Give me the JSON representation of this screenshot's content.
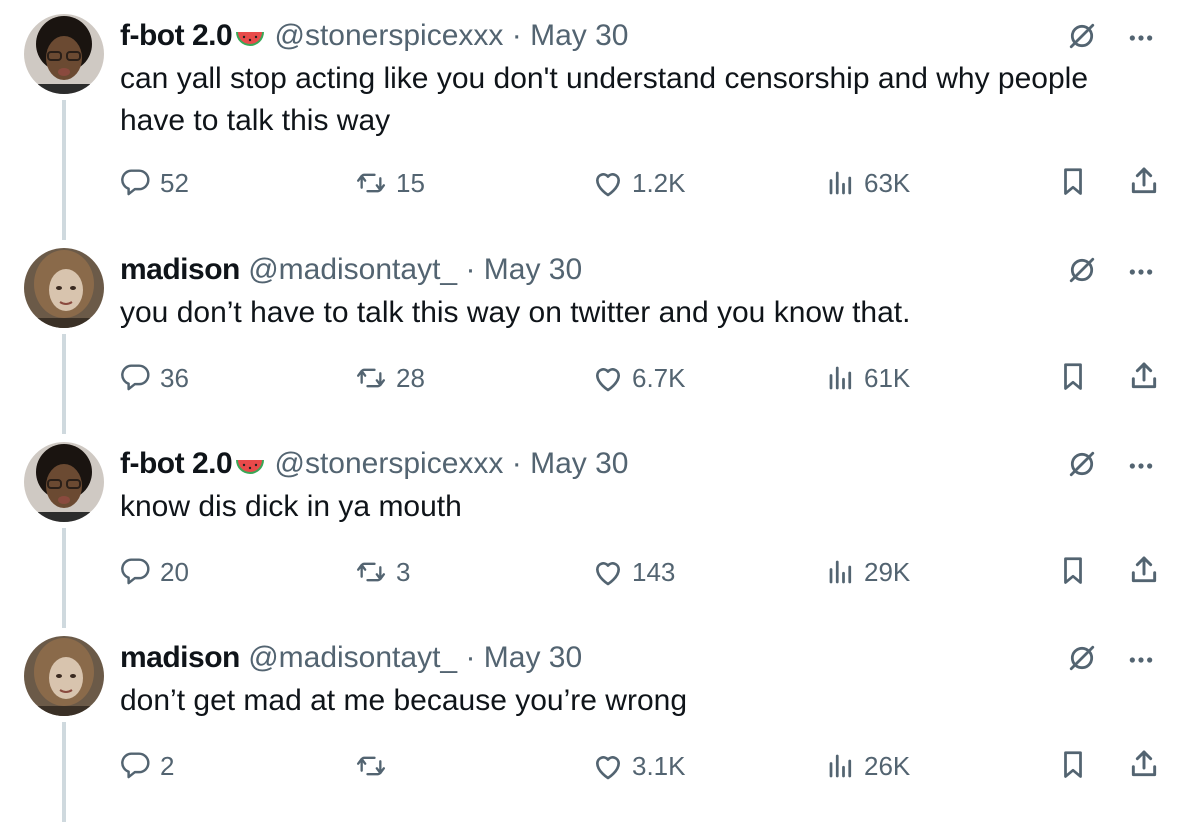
{
  "colors": {
    "text": "#0f1419",
    "muted": "#536471",
    "line": "#cfd9de"
  },
  "tweets": [
    {
      "name": "f-bot 2.0",
      "emoji": "watermelon-icon",
      "handle": "@stonerspicexxx",
      "dot": "·",
      "date": "May 30",
      "text": "can yall stop acting like you don't understand censorship and why people have to talk this way",
      "replies": "52",
      "reposts": "15",
      "likes": "1.2K",
      "views": "63K"
    },
    {
      "name": "madison",
      "emoji": "",
      "handle": "@madisontayt_",
      "dot": "·",
      "date": "May 30",
      "text": "you don’t have to talk this way on twitter and you know that.",
      "replies": "36",
      "reposts": "28",
      "likes": "6.7K",
      "views": "61K"
    },
    {
      "name": "f-bot 2.0",
      "emoji": "watermelon-icon",
      "handle": "@stonerspicexxx",
      "dot": "·",
      "date": "May 30",
      "text": "know dis dick in ya mouth",
      "replies": "20",
      "reposts": "3",
      "likes": "143",
      "views": "29K"
    },
    {
      "name": "madison",
      "emoji": "",
      "handle": "@madisontayt_",
      "dot": "·",
      "date": "May 30",
      "text": "don’t get mad at me because you’re wrong",
      "replies": "2",
      "reposts": "",
      "likes": "3.1K",
      "views": "26K"
    }
  ]
}
